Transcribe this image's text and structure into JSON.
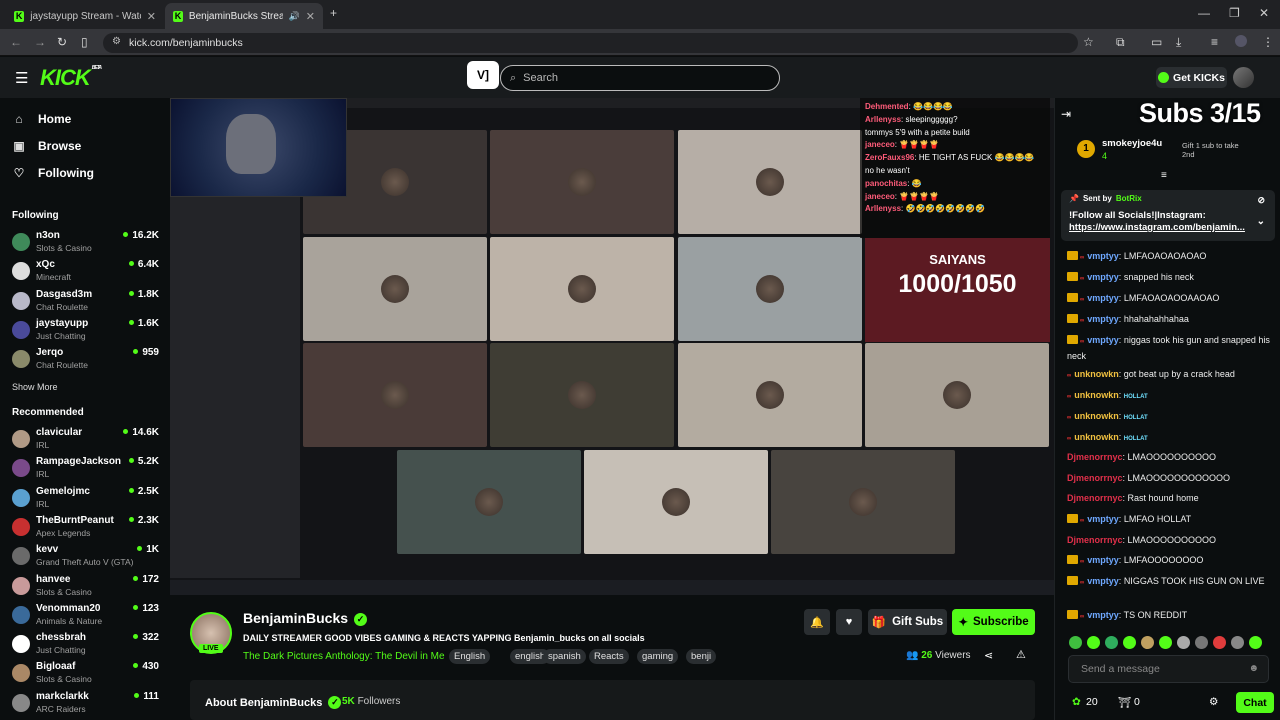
{
  "browser": {
    "tabs": [
      {
        "title": "jaystayupp Stream - Watch Live"
      },
      {
        "title": "BenjaminBucks Stream - Wa"
      }
    ],
    "url": "kick.com/benjaminbucks"
  },
  "header": {
    "logo": "KICK",
    "beta": "BETA",
    "search_placeholder": "Search",
    "get_kicks": "Get KICKs"
  },
  "sidebar": {
    "nav": [
      {
        "label": "Home",
        "icon": "home-icon"
      },
      {
        "label": "Browse",
        "icon": "browse-icon"
      },
      {
        "label": "Following",
        "icon": "heart-icon"
      }
    ],
    "following_title": "Following",
    "following": [
      {
        "name": "n3on",
        "category": "Slots & Casino",
        "viewers": "16.2K",
        "color": "#3f8a5a"
      },
      {
        "name": "xQc",
        "category": "Minecraft",
        "viewers": "6.4K",
        "color": "#dddddd"
      },
      {
        "name": "Dasgasd3m",
        "category": "Chat Roulette",
        "viewers": "1.8K",
        "color": "#b8b8c8"
      },
      {
        "name": "jaystayupp",
        "category": "Just Chatting",
        "viewers": "1.6K",
        "color": "#4a4a9a"
      },
      {
        "name": "Jerqo",
        "category": "Chat Roulette",
        "viewers": "959",
        "color": "#8a8a6a"
      }
    ],
    "show_more": "Show More",
    "recommended_title": "Recommended",
    "recommended": [
      {
        "name": "clavicular",
        "category": "IRL",
        "viewers": "14.6K",
        "color": "#b09a86"
      },
      {
        "name": "RampageJackson",
        "category": "IRL",
        "viewers": "5.2K",
        "color": "#7a4a8a"
      },
      {
        "name": "Gemelojmc",
        "category": "IRL",
        "viewers": "2.5K",
        "color": "#5aa0d0"
      },
      {
        "name": "TheBurntPeanut",
        "category": "Apex Legends",
        "viewers": "2.3K",
        "color": "#c83030"
      },
      {
        "name": "kevv",
        "category": "Grand Theft Auto V (GTA)",
        "viewers": "1K",
        "color": "#6a6a6a"
      },
      {
        "name": "hanvee",
        "category": "Slots & Casino",
        "viewers": "172",
        "color": "#c89a9a"
      },
      {
        "name": "Venomman20",
        "category": "Animals & Nature",
        "viewers": "123",
        "color": "#3a6a9a"
      },
      {
        "name": "chessbrah",
        "category": "Just Chatting",
        "viewers": "322",
        "color": "#ffffff"
      },
      {
        "name": "Bigloaaf",
        "category": "Slots & Casino",
        "viewers": "430",
        "color": "#aa8866"
      },
      {
        "name": "markclarkk",
        "category": "ARC Raiders",
        "viewers": "111",
        "color": "#888888"
      }
    ]
  },
  "stream": {
    "overlay_chat": [
      {
        "user": "Dehmented",
        "text": "😂😂😂😂"
      },
      {
        "user": "Arllenyss",
        "text": "sleepinggggg?"
      },
      {
        "user": "",
        "text": "tommys 5'9 with a petite build"
      },
      {
        "user": "janeceo",
        "text": "🍟🍟🍟🍟"
      },
      {
        "user": "ZeroFauxs96",
        "text": "HE TIGHT AS FUCK 😂😂😂😂"
      },
      {
        "user": "",
        "text": "no he wasn't"
      },
      {
        "user": "panochitas",
        "text": "😂"
      },
      {
        "user": "janeceo",
        "text": "🍟🍟🍟🍟"
      },
      {
        "user": "Arllenyss",
        "text": "🤣🤣🤣🤣🤣🤣🤣🤣"
      }
    ],
    "goal_title": "SAIYANS",
    "goal_count": "1000/1050"
  },
  "channel": {
    "name": "BenjaminBucks",
    "live": "LIVE",
    "title": "DAILY STREAMER GOOD VIBES GAMING & REACTS YAPPING Benjamin_bucks on all socials",
    "category": "The Dark Pictures Anthology: The Devil in Me",
    "tags": [
      "English",
      "english",
      "spanish",
      "Reacts",
      "gaming",
      "benji"
    ],
    "gift_subs": "Gift Subs",
    "subscribe": "Subscribe",
    "viewers_count": "26",
    "viewers_label": "Viewers",
    "about_title": "About BenjaminBucks",
    "followers_count": "5K",
    "followers_label": "Followers"
  },
  "chat": {
    "subs_overlay": "Subs 3/15",
    "top_gifter": {
      "rank": "1",
      "name": "smokeyjoe4u",
      "count": "4"
    },
    "gift_prompt": "Gift 1 sub to take 2nd",
    "pinned": {
      "sent_by_label": "Sent by",
      "sender": "BotRix",
      "line1": "!Follow all Socials!|Instagram:",
      "link": "https://www.instagram.com/benjamin..."
    },
    "messages": [
      {
        "user": "vmptyy",
        "text": "LMFAOAOAOAOAO",
        "color": "#6fa8ff",
        "crown": true
      },
      {
        "user": "vmptyy",
        "text": "snapped his neck",
        "color": "#6fa8ff",
        "crown": true
      },
      {
        "user": "vmptyy",
        "text": "LMFAOAOAOOAAOAO",
        "color": "#6fa8ff",
        "crown": true
      },
      {
        "user": "vmptyy",
        "text": "hhahahahhahaa",
        "color": "#6fa8ff",
        "crown": true
      },
      {
        "user": "vmptyy",
        "text": "niggas took his gun and snapped his neck",
        "color": "#6fa8ff",
        "crown": true
      },
      {
        "user": "unknowkn",
        "text": "got beat up by a crack head",
        "color": "#f0c040",
        "crown": false
      },
      {
        "user": "unknowkn",
        "text": "HOLLAT",
        "color": "#f0c040",
        "crown": false
      },
      {
        "user": "unknowkn",
        "text": "HOLLAT",
        "color": "#f0c040",
        "crown": false
      },
      {
        "user": "unknowkn",
        "text": "HOLLAT",
        "color": "#f0c040",
        "crown": false
      },
      {
        "user": "Djmenorrnyc",
        "text": "LMAOOOOOOOOOO",
        "color": "#e0304a",
        "crown": false
      },
      {
        "user": "Djmenorrnyc",
        "text": "LMAOOOOOOOOOOOO",
        "color": "#e0304a",
        "crown": false
      },
      {
        "user": "Djmenorrnyc",
        "text": "Rast hound home",
        "color": "#e0304a",
        "crown": false
      },
      {
        "user": "vmptyy",
        "text": "LMFAO HOLLAT",
        "color": "#6fa8ff",
        "crown": true
      },
      {
        "user": "Djmenorrnyc",
        "text": "LMAOOOOOOOOOO",
        "color": "#e0304a",
        "crown": false
      },
      {
        "user": "vmptyy",
        "text": "LMFAOOOOOOOO",
        "color": "#6fa8ff",
        "crown": true
      },
      {
        "user": "vmptyy",
        "text": "NIGGAS TOOK HIS GUN ON LIVE",
        "color": "#6fa8ff",
        "crown": true
      },
      {
        "user": "vmptyy",
        "text": "TS ON REDDIT",
        "color": "#6fa8ff",
        "crown": true
      }
    ],
    "input_placeholder": "Send a message",
    "points": "20",
    "stat2": "0",
    "chat_button": "Chat"
  }
}
